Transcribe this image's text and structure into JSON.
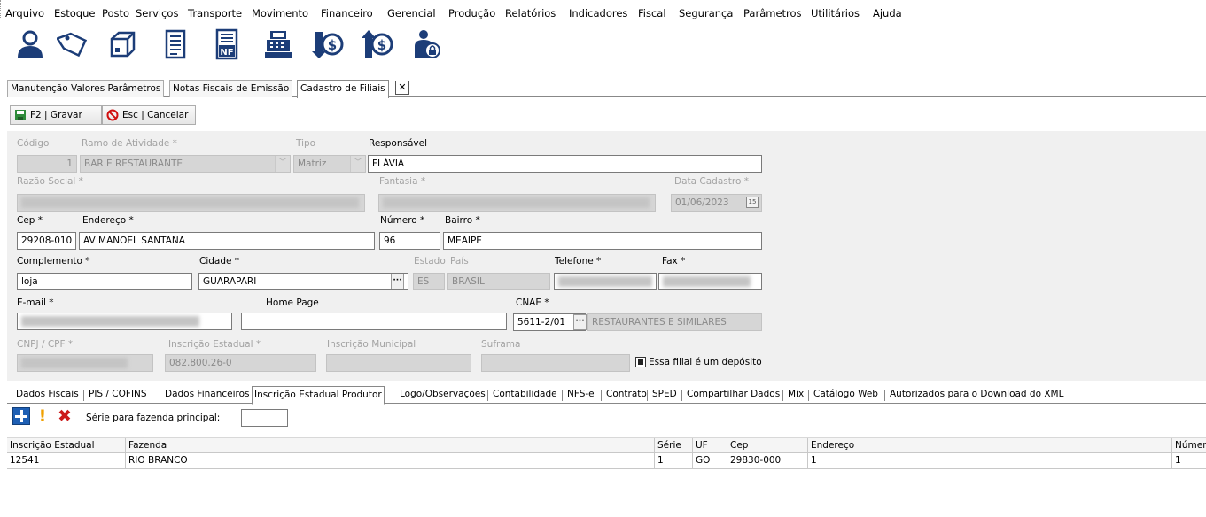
{
  "menu": [
    "Arquivo",
    "Estoque",
    "Posto",
    "Serviços",
    "Transporte",
    "Movimento",
    "Financeiro",
    "Gerencial",
    "Produção",
    "Relatórios",
    "Indicadores",
    "Fiscal",
    "Segurança",
    "Parâmetros",
    "Utilitários",
    "Ajuda"
  ],
  "toolbar_icons": [
    "user-icon",
    "tag-icon",
    "box-icon",
    "document-icon",
    "nf-document-icon",
    "cash-register-icon",
    "money-out-icon",
    "money-in-icon",
    "user-lock-icon"
  ],
  "toolbar_nf_text": "NF",
  "doc_tabs": [
    "Manutenção Valores Parâmetros",
    "Notas Fiscais de Emissão",
    "Cadastro de Filiais"
  ],
  "doc_tab_close": "✕",
  "actions": {
    "save": "F2 | Gravar",
    "cancel": "Esc | Cancelar"
  },
  "form": {
    "codigo_label": "Código",
    "codigo": "1",
    "ramo_label": "Ramo de Atividade *",
    "ramo": "BAR E RESTAURANTE",
    "tipo_label": "Tipo",
    "tipo": "Matriz",
    "responsavel_label": "Responsável",
    "responsavel": "FLÁVIA",
    "razao_label": "Razão Social *",
    "fantasia_label": "Fantasia *",
    "data_label": "Data Cadastro *",
    "data": "01/06/2023",
    "data_btn": "15",
    "cep_label": "Cep *",
    "cep": "29208-010",
    "endereco_label": "Endereço *",
    "endereco": "AV MANOEL SANTANA",
    "numero_label": "Número *",
    "numero": "96",
    "bairro_label": "Bairro *",
    "bairro": "MEAIPE",
    "complemento_label": "Complemento *",
    "complemento": "loja",
    "cidade_label": "Cidade *",
    "cidade": "GUARAPARI",
    "estado_label": "Estado",
    "estado": "ES",
    "pais_label": "País",
    "pais": "BRASIL",
    "telefone_label": "Telefone *",
    "fax_label": "Fax *",
    "email_label": "E-mail *",
    "homepage_label": "Home Page",
    "cnae_label": "CNAE *",
    "cnae": "5611-2/01",
    "cnae_desc": "RESTAURANTES E SIMILARES",
    "cnpj_label": "CNPJ / CPF *",
    "ie_label": "Inscrição Estadual *",
    "ie": "082.800.26-0",
    "im_label": "Inscrição Municipal",
    "suframa_label": "Suframa",
    "deposito_label": "Essa filial é um depósito",
    "ellipsis": "···"
  },
  "sub_tabs": [
    "Dados Fiscais",
    "PIS / COFINS",
    "Dados Financeiros",
    "Inscrição Estadual Produtor",
    "Logo/Observações",
    "Contabilidade",
    "NFS-e",
    "Contrato",
    "SPED",
    "Compartilhar Dados",
    "Mix",
    "Catálogo Web",
    "Autorizados para o Download do XML"
  ],
  "serie_label": "Série para fazenda principal:",
  "grid": {
    "columns": [
      "Inscrição Estadual",
      "Fazenda",
      "Série",
      "UF",
      "Cep",
      "Endereço",
      "Númer"
    ],
    "rows": [
      [
        "12541",
        "RIO BRANCO",
        "1",
        "GO",
        "29830-000",
        "1",
        "1"
      ]
    ]
  },
  "colors": {
    "accent_blue": "#1e5fb4",
    "icon_dark": "#1c3d78",
    "form_bg": "#f0f0f0",
    "disabled_bg": "#d6d6d6"
  }
}
